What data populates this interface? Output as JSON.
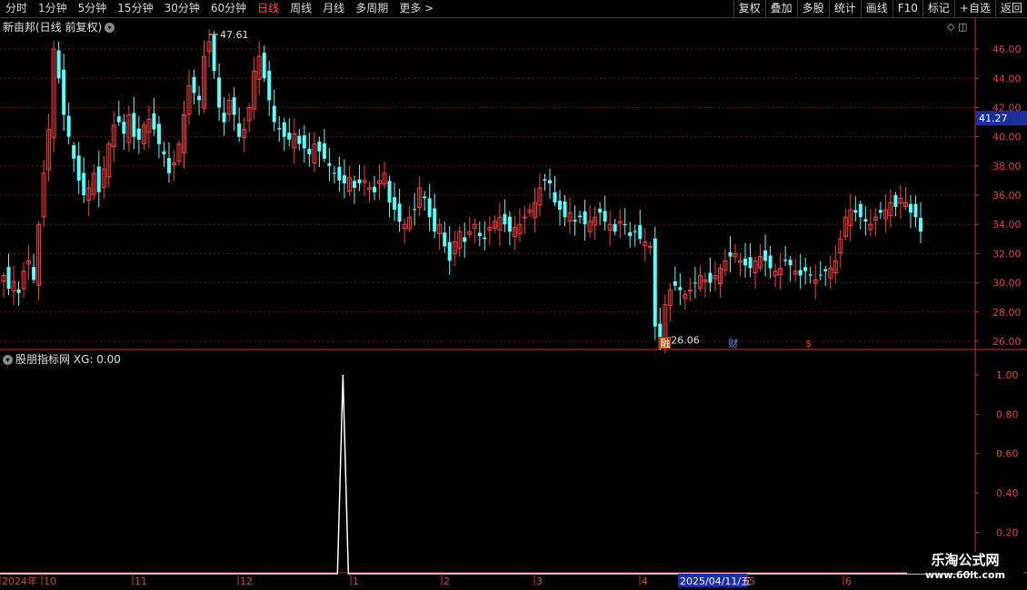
{
  "toolbar": {
    "periods": [
      "分时",
      "1分钟",
      "5分钟",
      "15分钟",
      "30分钟",
      "60分钟",
      "日线",
      "周线",
      "月线",
      "多周期",
      "更多 >"
    ],
    "active_period": "日线",
    "right_buttons": [
      "复权",
      "叠加",
      "多股",
      "统计",
      "画线",
      "F10",
      "标记",
      "+自选",
      "返回"
    ]
  },
  "main_title": "新亩邦(日线 前复权)",
  "sub_title": "股朋指标网",
  "sub_value": "XG: 0.00",
  "watermark": {
    "line1": "乐淘公式网",
    "line2": "www.60lt.com"
  },
  "colors": {
    "up": "#ff3b3b",
    "down": "#54ffff",
    "grid": "#7a1010",
    "axis": "#c83232",
    "price_box": "#1b2fa0"
  },
  "chart_data": {
    "type": "candlestick",
    "y_ticks": [
      "46.00",
      "44.00",
      "42.00",
      "40.00",
      "38.00",
      "36.00",
      "34.00",
      "32.00",
      "30.00",
      "28.00",
      "26.00"
    ],
    "current_price": "41.27",
    "high_label": "47.61",
    "low_label": "26.06",
    "markers": [
      "融",
      "财",
      "$"
    ],
    "indicator_ticks": [
      "1.00",
      "0.80",
      "0.60",
      "0.40",
      "0.20"
    ],
    "x_labels": [
      "2024年",
      "10",
      "11",
      "12",
      "1",
      "2",
      "3",
      "4",
      "2025/04/11/五",
      "5",
      "6"
    ],
    "closes": [
      30.5,
      29.6,
      30.1,
      29.3,
      30.8,
      31.5,
      30.2,
      34.0,
      37.5,
      40.5,
      46.0,
      44.0,
      41.5,
      40.0,
      38.5,
      37.0,
      36.0,
      36.5,
      37.5,
      36.2,
      37.8,
      39.5,
      40.8,
      41.0,
      40.2,
      41.5,
      40.0,
      39.8,
      40.8,
      41.2,
      40.5,
      39.5,
      38.8,
      37.5,
      38.2,
      39.5,
      41.5,
      43.5,
      43.0,
      42.5,
      45.5,
      46.5,
      44.5,
      42.0,
      41.0,
      42.5,
      41.5,
      40.0,
      40.5,
      42.0,
      44.5,
      45.5,
      44.0,
      42.5,
      41.0,
      40.5,
      40.0,
      39.8,
      40.2,
      39.5,
      39.2,
      38.8,
      39.5,
      39.0,
      38.5,
      38.0,
      37.5,
      37.0,
      36.8,
      37.2,
      36.5,
      36.8,
      37.0,
      36.5,
      36.2,
      37.0,
      37.5,
      35.5,
      35.0,
      34.2,
      34.0,
      34.5,
      35.0,
      36.5,
      35.8,
      34.5,
      33.5,
      34.0,
      32.5,
      31.5,
      32.8,
      33.5,
      32.8,
      33.5,
      34.0,
      33.2,
      33.0,
      33.8,
      34.2,
      34.5,
      34.0,
      33.5,
      33.8,
      34.0,
      34.5,
      35.0,
      35.5,
      36.5,
      37.0,
      36.8,
      35.5,
      35.0,
      34.5,
      34.8,
      34.2,
      34.5,
      34.0,
      34.2,
      34.5,
      34.8,
      34.2,
      34.0,
      33.5,
      34.2,
      34.0,
      33.2,
      33.5,
      33.0,
      32.8,
      32.5,
      27.0,
      26.3,
      28.5,
      29.5,
      29.8,
      29.5,
      29.2,
      29.5,
      30.0,
      30.5,
      30.2,
      30.0,
      30.5,
      31.0,
      31.5,
      31.8,
      32.0,
      31.5,
      31.2,
      31.0,
      31.5,
      31.8,
      31.5,
      31.0,
      30.8,
      31.0,
      31.5,
      31.2,
      30.8,
      30.5,
      30.8,
      30.5,
      30.2,
      30.5,
      30.8,
      31.0,
      31.5,
      33.0,
      34.5,
      35.0,
      34.8,
      34.5,
      34.2,
      34.0,
      34.5,
      34.8,
      35.0,
      35.5,
      35.2,
      35.8,
      35.5,
      34.8,
      34.5,
      33.5
    ],
    "signal_index": 0.37,
    "signal_value": 1.0
  }
}
